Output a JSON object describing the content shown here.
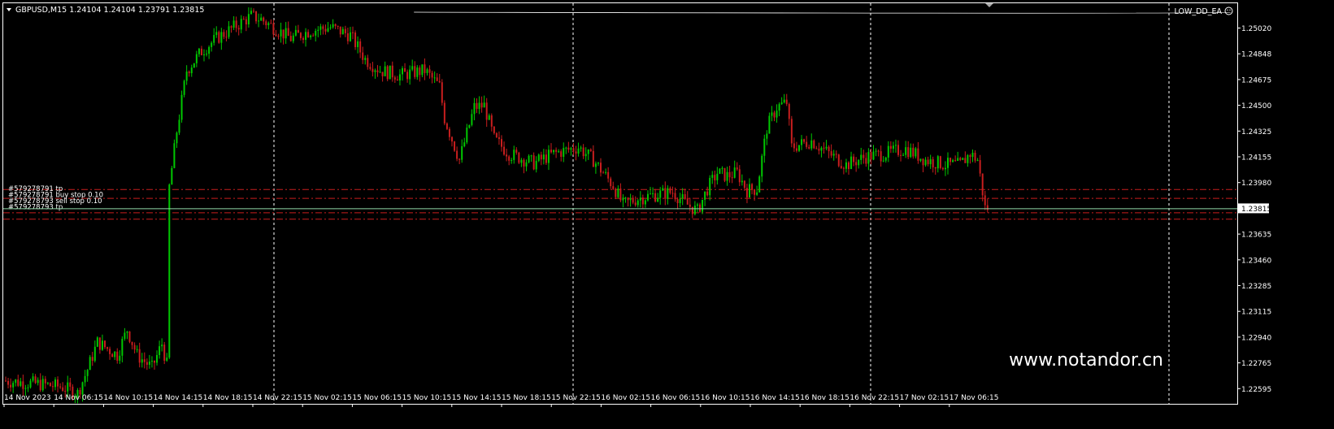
{
  "header": {
    "symbol_info": "GBPUSD,M15  1.24104 1.24104 1.23791 1.23815",
    "expert": "LOW_DD_EA",
    "watermark": "www.notandor.cn"
  },
  "colors": {
    "background": "#000000",
    "bull": "#00c800",
    "bear": "#c81e1e",
    "grid": "#ffffff",
    "order_line": "#c81e1e",
    "bid_line": "#90d8a8",
    "text": "#ffffff"
  },
  "chart_data": {
    "type": "candlestick",
    "title": "GBPUSD,M15",
    "ohlc_header": {
      "open": 1.24104,
      "high": 1.24104,
      "low": 1.23791,
      "close": 1.23815
    },
    "ylim": [
      1.22595,
      1.251
    ],
    "y_ticks": [
      "1.25020",
      "1.24848",
      "1.24675",
      "1.24500",
      "1.24325",
      "1.24155",
      "1.23980",
      "1.23815",
      "1.23635",
      "1.23460",
      "1.23285",
      "1.23115",
      "1.22940",
      "1.22765",
      "1.22595"
    ],
    "x_ticks": [
      "14 Nov 2023",
      "14 Nov 06:15",
      "14 Nov 10:15",
      "14 Nov 14:15",
      "14 Nov 18:15",
      "14 Nov 22:15",
      "15 Nov 02:15",
      "15 Nov 06:15",
      "15 Nov 10:15",
      "15 Nov 14:15",
      "15 Nov 18:15",
      "15 Nov 22:15",
      "16 Nov 02:15",
      "16 Nov 06:15",
      "16 Nov 10:15",
      "16 Nov 14:15",
      "16 Nov 18:15",
      "16 Nov 22:15",
      "17 Nov 02:15",
      "17 Nov 06:15"
    ],
    "current_price": "1.23815",
    "path": [
      [
        0,
        1.2274
      ],
      [
        14,
        1.2272
      ],
      [
        24,
        1.227
      ],
      [
        30,
        1.2266
      ],
      [
        34,
        1.2281
      ],
      [
        38,
        1.2298
      ],
      [
        46,
        1.229
      ],
      [
        50,
        1.2306
      ],
      [
        54,
        1.229
      ],
      [
        60,
        1.2282
      ],
      [
        64,
        1.2297
      ],
      [
        66,
        1.2284
      ],
      [
        67,
        1.2395
      ],
      [
        70,
        1.243
      ],
      [
        74,
        1.2468
      ],
      [
        80,
        1.248
      ],
      [
        86,
        1.2488
      ],
      [
        94,
        1.2496
      ],
      [
        100,
        1.2502
      ],
      [
        104,
        1.25
      ],
      [
        110,
        1.2494
      ],
      [
        116,
        1.2488
      ],
      [
        124,
        1.2493
      ],
      [
        132,
        1.2495
      ],
      [
        140,
        1.249
      ],
      [
        146,
        1.2475
      ],
      [
        152,
        1.2468
      ],
      [
        160,
        1.2465
      ],
      [
        170,
        1.2468
      ],
      [
        176,
        1.2458
      ],
      [
        178,
        1.2438
      ],
      [
        184,
        1.2412
      ],
      [
        190,
        1.2445
      ],
      [
        194,
        1.2446
      ],
      [
        198,
        1.2425
      ],
      [
        204,
        1.2416
      ],
      [
        214,
        1.241
      ],
      [
        222,
        1.2416
      ],
      [
        232,
        1.242
      ],
      [
        238,
        1.2412
      ],
      [
        246,
        1.2396
      ],
      [
        250,
        1.2384
      ],
      [
        256,
        1.2388
      ],
      [
        262,
        1.239
      ],
      [
        270,
        1.2392
      ],
      [
        276,
        1.2384
      ],
      [
        280,
        1.238
      ],
      [
        284,
        1.2394
      ],
      [
        288,
        1.2404
      ],
      [
        292,
        1.2402
      ],
      [
        296,
        1.2404
      ],
      [
        300,
        1.2393
      ],
      [
        304,
        1.2394
      ],
      [
        308,
        1.2432
      ],
      [
        312,
        1.2445
      ],
      [
        316,
        1.2448
      ],
      [
        318,
        1.242
      ],
      [
        326,
        1.2424
      ],
      [
        334,
        1.2415
      ],
      [
        340,
        1.2409
      ],
      [
        348,
        1.2414
      ],
      [
        356,
        1.2416
      ],
      [
        364,
        1.2419
      ],
      [
        372,
        1.2412
      ],
      [
        380,
        1.2409
      ],
      [
        386,
        1.2409
      ],
      [
        390,
        1.2416
      ],
      [
        393,
        1.2412
      ],
      [
        396,
        1.2382
      ]
    ],
    "orders": [
      {
        "label": "#579278791 tp",
        "price": 1.23935
      },
      {
        "label": "#579278791 buy stop 0.10",
        "price": 1.2388
      },
      {
        "label": "#579278793 sell stop 0.10",
        "price": 1.2379
      },
      {
        "label": "#579278793 tp",
        "price": 1.2375
      }
    ]
  }
}
